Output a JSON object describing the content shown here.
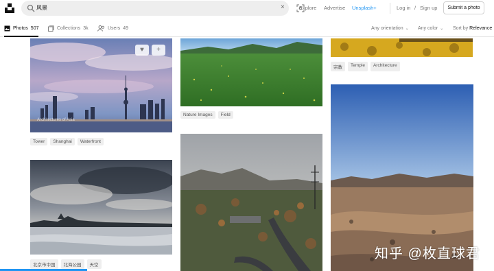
{
  "search": {
    "query": "风景",
    "clear_glyph": "×"
  },
  "nav": {
    "explore": "Explore",
    "advertise": "Advertise",
    "unsplash_plus": "Unsplash+",
    "login": "Log in",
    "divider": "/",
    "signup": "Sign up",
    "submit": "Submit a photo"
  },
  "tabs": [
    {
      "label": "Photos",
      "count": "507"
    },
    {
      "label": "Collections",
      "count": "3k"
    },
    {
      "label": "Users",
      "count": "49"
    }
  ],
  "filters": {
    "orientation": "Any orientation",
    "color": "Any color",
    "sort_prefix": "Sort by",
    "sort_value": "Relevance"
  },
  "photos": {
    "shanghai_tags": [
      "Tower",
      "Shanghai",
      "Waterfront"
    ],
    "shanghai_author": "Architectures of Asia",
    "grassland_tags": [
      "Nature Images",
      "Field"
    ],
    "temple_tags": [
      "宗教",
      "Temple",
      "Architecture"
    ],
    "lake_tags": [
      "北京市中国",
      "北海公园",
      "天空"
    ]
  },
  "watermark": "知乎 @枚直球君",
  "colors": {
    "accent": "#2196f3",
    "text": "#111111",
    "muted": "#767676"
  }
}
